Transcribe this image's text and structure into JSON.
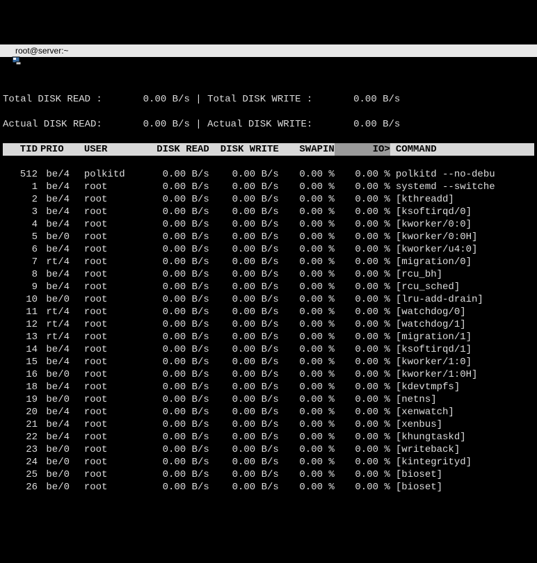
{
  "window": {
    "title": "root@server:~"
  },
  "summary": {
    "total_read_label": "Total DISK READ :",
    "total_read_value": "0.00 B/s",
    "total_write_label": "Total DISK WRITE :",
    "total_write_value": "0.00 B/s",
    "actual_read_label": "Actual DISK READ:",
    "actual_read_value": "0.00 B/s",
    "actual_write_label": "Actual DISK WRITE:",
    "actual_write_value": "0.00 B/s",
    "divider": "|"
  },
  "columns": {
    "tid": "TID",
    "prio": "PRIO",
    "user": "USER",
    "read": "DISK READ",
    "write": "DISK WRITE",
    "swap": "SWAPIN",
    "io": "IO>",
    "cmd": "COMMAND"
  },
  "rows": [
    {
      "tid": "512",
      "prio": "be/4",
      "user": "polkitd",
      "read": "0.00 B/s",
      "write": "0.00 B/s",
      "swap": "0.00 %",
      "io": "0.00 %",
      "cmd": "polkitd --no-debu"
    },
    {
      "tid": "1",
      "prio": "be/4",
      "user": "root",
      "read": "0.00 B/s",
      "write": "0.00 B/s",
      "swap": "0.00 %",
      "io": "0.00 %",
      "cmd": "systemd --switche"
    },
    {
      "tid": "2",
      "prio": "be/4",
      "user": "root",
      "read": "0.00 B/s",
      "write": "0.00 B/s",
      "swap": "0.00 %",
      "io": "0.00 %",
      "cmd": "[kthreadd]"
    },
    {
      "tid": "3",
      "prio": "be/4",
      "user": "root",
      "read": "0.00 B/s",
      "write": "0.00 B/s",
      "swap": "0.00 %",
      "io": "0.00 %",
      "cmd": "[ksoftirqd/0]"
    },
    {
      "tid": "4",
      "prio": "be/4",
      "user": "root",
      "read": "0.00 B/s",
      "write": "0.00 B/s",
      "swap": "0.00 %",
      "io": "0.00 %",
      "cmd": "[kworker/0:0]"
    },
    {
      "tid": "5",
      "prio": "be/0",
      "user": "root",
      "read": "0.00 B/s",
      "write": "0.00 B/s",
      "swap": "0.00 %",
      "io": "0.00 %",
      "cmd": "[kworker/0:0H]"
    },
    {
      "tid": "6",
      "prio": "be/4",
      "user": "root",
      "read": "0.00 B/s",
      "write": "0.00 B/s",
      "swap": "0.00 %",
      "io": "0.00 %",
      "cmd": "[kworker/u4:0]"
    },
    {
      "tid": "7",
      "prio": "rt/4",
      "user": "root",
      "read": "0.00 B/s",
      "write": "0.00 B/s",
      "swap": "0.00 %",
      "io": "0.00 %",
      "cmd": "[migration/0]"
    },
    {
      "tid": "8",
      "prio": "be/4",
      "user": "root",
      "read": "0.00 B/s",
      "write": "0.00 B/s",
      "swap": "0.00 %",
      "io": "0.00 %",
      "cmd": "[rcu_bh]"
    },
    {
      "tid": "9",
      "prio": "be/4",
      "user": "root",
      "read": "0.00 B/s",
      "write": "0.00 B/s",
      "swap": "0.00 %",
      "io": "0.00 %",
      "cmd": "[rcu_sched]"
    },
    {
      "tid": "10",
      "prio": "be/0",
      "user": "root",
      "read": "0.00 B/s",
      "write": "0.00 B/s",
      "swap": "0.00 %",
      "io": "0.00 %",
      "cmd": "[lru-add-drain]"
    },
    {
      "tid": "11",
      "prio": "rt/4",
      "user": "root",
      "read": "0.00 B/s",
      "write": "0.00 B/s",
      "swap": "0.00 %",
      "io": "0.00 %",
      "cmd": "[watchdog/0]"
    },
    {
      "tid": "12",
      "prio": "rt/4",
      "user": "root",
      "read": "0.00 B/s",
      "write": "0.00 B/s",
      "swap": "0.00 %",
      "io": "0.00 %",
      "cmd": "[watchdog/1]"
    },
    {
      "tid": "13",
      "prio": "rt/4",
      "user": "root",
      "read": "0.00 B/s",
      "write": "0.00 B/s",
      "swap": "0.00 %",
      "io": "0.00 %",
      "cmd": "[migration/1]"
    },
    {
      "tid": "14",
      "prio": "be/4",
      "user": "root",
      "read": "0.00 B/s",
      "write": "0.00 B/s",
      "swap": "0.00 %",
      "io": "0.00 %",
      "cmd": "[ksoftirqd/1]"
    },
    {
      "tid": "15",
      "prio": "be/4",
      "user": "root",
      "read": "0.00 B/s",
      "write": "0.00 B/s",
      "swap": "0.00 %",
      "io": "0.00 %",
      "cmd": "[kworker/1:0]"
    },
    {
      "tid": "16",
      "prio": "be/0",
      "user": "root",
      "read": "0.00 B/s",
      "write": "0.00 B/s",
      "swap": "0.00 %",
      "io": "0.00 %",
      "cmd": "[kworker/1:0H]"
    },
    {
      "tid": "18",
      "prio": "be/4",
      "user": "root",
      "read": "0.00 B/s",
      "write": "0.00 B/s",
      "swap": "0.00 %",
      "io": "0.00 %",
      "cmd": "[kdevtmpfs]"
    },
    {
      "tid": "19",
      "prio": "be/0",
      "user": "root",
      "read": "0.00 B/s",
      "write": "0.00 B/s",
      "swap": "0.00 %",
      "io": "0.00 %",
      "cmd": "[netns]"
    },
    {
      "tid": "20",
      "prio": "be/4",
      "user": "root",
      "read": "0.00 B/s",
      "write": "0.00 B/s",
      "swap": "0.00 %",
      "io": "0.00 %",
      "cmd": "[xenwatch]"
    },
    {
      "tid": "21",
      "prio": "be/4",
      "user": "root",
      "read": "0.00 B/s",
      "write": "0.00 B/s",
      "swap": "0.00 %",
      "io": "0.00 %",
      "cmd": "[xenbus]"
    },
    {
      "tid": "22",
      "prio": "be/4",
      "user": "root",
      "read": "0.00 B/s",
      "write": "0.00 B/s",
      "swap": "0.00 %",
      "io": "0.00 %",
      "cmd": "[khungtaskd]"
    },
    {
      "tid": "23",
      "prio": "be/0",
      "user": "root",
      "read": "0.00 B/s",
      "write": "0.00 B/s",
      "swap": "0.00 %",
      "io": "0.00 %",
      "cmd": "[writeback]"
    },
    {
      "tid": "24",
      "prio": "be/0",
      "user": "root",
      "read": "0.00 B/s",
      "write": "0.00 B/s",
      "swap": "0.00 %",
      "io": "0.00 %",
      "cmd": "[kintegrityd]"
    },
    {
      "tid": "25",
      "prio": "be/0",
      "user": "root",
      "read": "0.00 B/s",
      "write": "0.00 B/s",
      "swap": "0.00 %",
      "io": "0.00 %",
      "cmd": "[bioset]"
    },
    {
      "tid": "26",
      "prio": "be/0",
      "user": "root",
      "read": "0.00 B/s",
      "write": "0.00 B/s",
      "swap": "0.00 %",
      "io": "0.00 %",
      "cmd": "[bioset]"
    }
  ]
}
